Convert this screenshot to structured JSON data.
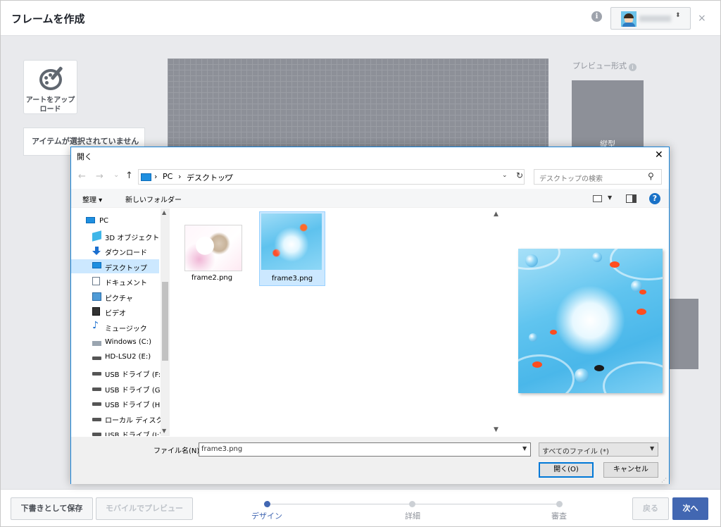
{
  "header": {
    "title": "フレームを作成",
    "info_icon": "i",
    "close_icon": "×",
    "account_caret": "⬍"
  },
  "left": {
    "upload_label": "アートをアップロード",
    "no_item": "アイテムが選択されていません"
  },
  "preview_panel": {
    "label": "プレビュー形式",
    "portrait": "縦型"
  },
  "footer": {
    "save_draft": "下書きとして保存",
    "mobile_preview": "モバイルでプレビュー",
    "steps": [
      {
        "label": "デザイン",
        "active": true
      },
      {
        "label": "詳細",
        "active": false
      },
      {
        "label": "審査",
        "active": false
      }
    ],
    "back": "戻る",
    "next": "次へ"
  },
  "dialog": {
    "title": "開く",
    "close": "✕",
    "nav": {
      "back": "←",
      "forward": "→",
      "recent": "⌄",
      "up": "↑"
    },
    "breadcrumb": [
      "PC",
      "デスクトップ"
    ],
    "search_placeholder": "デスクトップの検索",
    "toolbar": {
      "organize": "整理 ▾",
      "new_folder": "新しいフォルダー",
      "help": "?"
    },
    "tree": [
      {
        "label": "PC",
        "icon": "pc-icon",
        "selected": false
      },
      {
        "label": "3D オブジェクト",
        "icon": "3d-objects-icon",
        "selected": false
      },
      {
        "label": "ダウンロード",
        "icon": "download-icon",
        "selected": false
      },
      {
        "label": "デスクトップ",
        "icon": "desktop-icon",
        "selected": true
      },
      {
        "label": "ドキュメント",
        "icon": "document-icon",
        "selected": false
      },
      {
        "label": "ピクチャ",
        "icon": "pictures-icon",
        "selected": false
      },
      {
        "label": "ビデオ",
        "icon": "video-icon",
        "selected": false
      },
      {
        "label": "ミュージック",
        "icon": "music-icon",
        "selected": false
      },
      {
        "label": "Windows (C:)",
        "icon": "windows-drive-icon",
        "selected": false
      },
      {
        "label": "HD-LSU2 (E:)",
        "icon": "drive-icon",
        "selected": false
      },
      {
        "label": "USB ドライブ (F:)",
        "icon": "drive-icon",
        "selected": false
      },
      {
        "label": "USB ドライブ (G:)",
        "icon": "drive-icon",
        "selected": false
      },
      {
        "label": "USB ドライブ (H:)",
        "icon": "drive-icon",
        "selected": false
      },
      {
        "label": "ローカル ディスク (I:",
        "icon": "drive-icon",
        "selected": false
      },
      {
        "label": "USB ドライブ (J:)",
        "icon": "drive-icon",
        "selected": false
      }
    ],
    "files": [
      {
        "name": "frame2.png",
        "selected": false
      },
      {
        "name": "frame3.png",
        "selected": true
      }
    ],
    "filename_label": "ファイル名(N):",
    "filename_value": "frame3.png",
    "filetype": "すべてのファイル (*)",
    "open_button": "開く(O)",
    "cancel_button": "キャンセル"
  }
}
